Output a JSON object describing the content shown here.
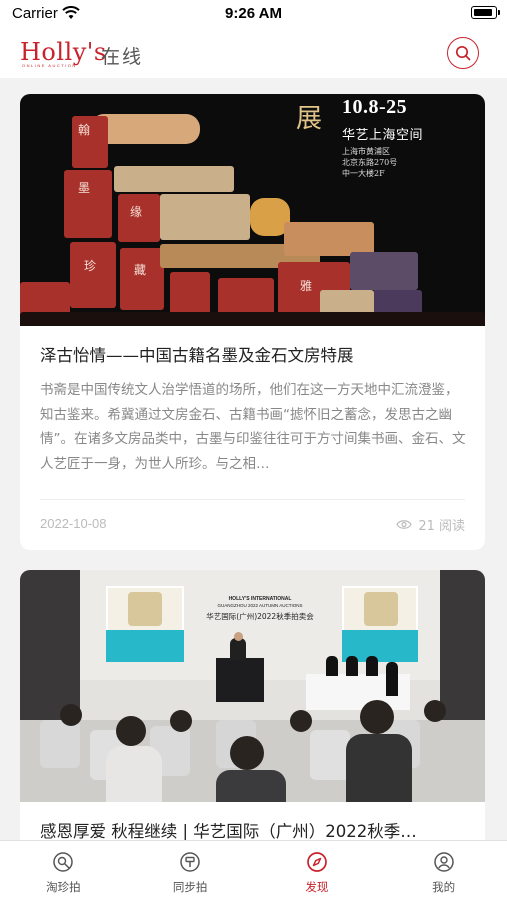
{
  "status_bar": {
    "carrier": "Carrier",
    "time": "9:26 AM"
  },
  "header": {
    "logo_text": "Holly's",
    "logo_subtext": "ONLINE AUCTION",
    "logo_cn": "在线",
    "search_icon": "search-icon"
  },
  "feed": {
    "articles": [
      {
        "title": "泽古怡情——中国古籍名墨及金石文房特展",
        "summary": "书斋是中国传统文人治学悟道的场所，他们在这一方天地中汇流澄鉴，知古鉴来。希冀通过文房金石、古籍书画“摅怀旧之蓄念，发思古之幽情”。在诸多文房品类中，古墨与印鉴往往可于方寸间集书画、金石、文人艺匠于一身，为世人所珍。与之相…",
        "date": "2022-10-08",
        "reads": "21 阅读",
        "image": {
          "poster_big_char": "展",
          "poster_date": "10.8-25",
          "poster_venue": "华艺上海空间",
          "poster_address_lines": [
            "上海市黄浦区",
            "北京东路270号",
            "中一大楼2F"
          ],
          "seal_chars": [
            "翰",
            "墨",
            "缘",
            "珍",
            "藏",
            "雅"
          ]
        }
      },
      {
        "title": "感恩厚爱 秋程继续 | 华艺国际（广州）2022秋季…",
        "image": {
          "banner_en_1": "HOLLY'S INTERNATIONAL",
          "banner_en_2": "GUANGZHOU 2022 AUTUMN AUCTIONS",
          "banner_cn": "华艺国际(广州)2022秋季拍卖会"
        }
      }
    ]
  },
  "tab_bar": {
    "tabs": [
      {
        "label": "淘珍拍",
        "icon": "auction-search-icon",
        "active": false
      },
      {
        "label": "同步拍",
        "icon": "gavel-icon",
        "active": false
      },
      {
        "label": "发现",
        "icon": "discover-icon",
        "active": true
      },
      {
        "label": "我的",
        "icon": "profile-icon",
        "active": false
      }
    ]
  },
  "colors": {
    "accent": "#c8232c",
    "background": "#f2f2f2",
    "muted_text": "#888888"
  }
}
